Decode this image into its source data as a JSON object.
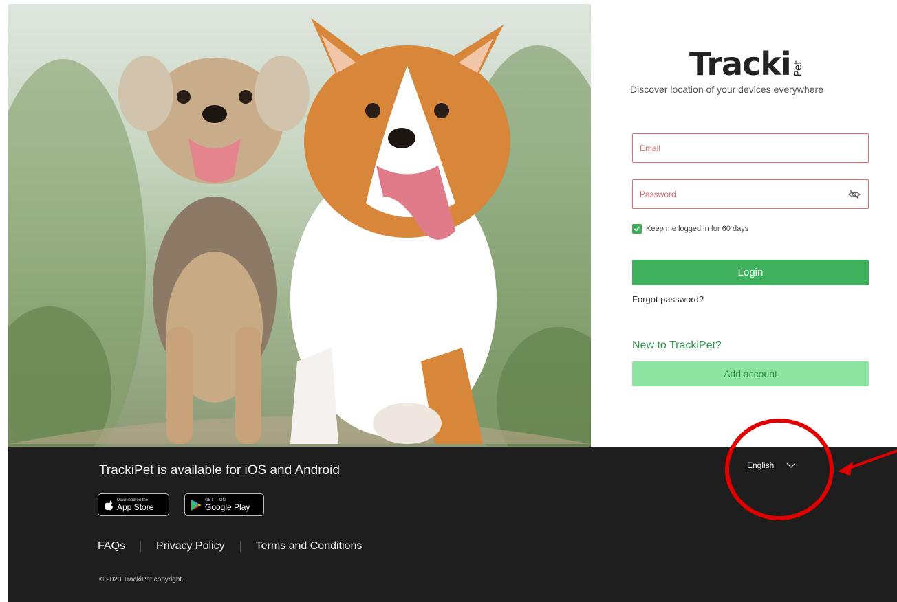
{
  "brand": {
    "logo_text": "Tracki",
    "logo_sub": "Pet",
    "tagline": "Discover location of your devices everywhere"
  },
  "login": {
    "email_placeholder": "Email",
    "password_placeholder": "Password",
    "remember_label": "Keep me logged in for 60 days",
    "remember_checked": true,
    "login_button": "Login",
    "forgot_link": "Forgot password?",
    "new_to": "New to TrackiPet?",
    "add_account_button": "Add account"
  },
  "footer": {
    "available_text": "TrackiPet is available for iOS and Android",
    "app_store": {
      "small": "Download on the",
      "big": "App Store"
    },
    "google_play": {
      "small": "GET IT ON",
      "big": "Google Play"
    },
    "links": [
      "FAQs",
      "Privacy Policy",
      "Terms and Conditions"
    ],
    "copyright": "© 2023 TrackiPet copyright.",
    "language": "English"
  },
  "colors": {
    "accent_green": "#3fb05c",
    "light_green": "#8de4a0",
    "error_red": "#e26a6a",
    "footer_bg": "#1e1e1e",
    "annotation_red": "#e00000"
  },
  "icons": [
    "eye-off-icon",
    "checkbox-check-icon",
    "apple-icon",
    "google-play-icon",
    "chevron-down-icon",
    "location-pin-icon"
  ]
}
